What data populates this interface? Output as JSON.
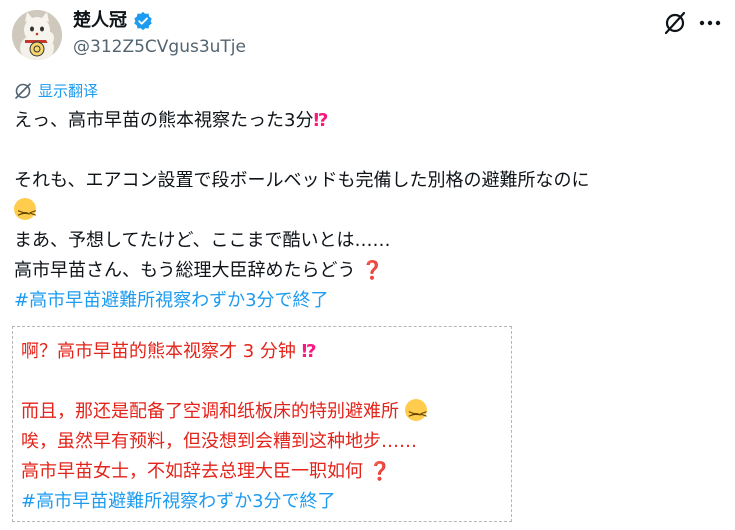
{
  "author": {
    "display_name": "楚人冠",
    "handle": "@312Z5CVgus3uTje",
    "verified": true,
    "avatar_icon": "maneki-neko-avatar"
  },
  "actions": {
    "grok_icon": "grok-icon",
    "more_icon": "more-horizontal-icon"
  },
  "translate": {
    "label": "显示翻译",
    "icon": "translate-icon"
  },
  "tweet": {
    "line1": "えっ、高市早苗の熊本視察たった3分",
    "line1_emoji": "⁉",
    "line2": "それも、エアコン設置で段ボールベッドも完備した別格の避難所なのに",
    "line3": "まあ、予想してたけど、ここまで酷いとは……",
    "line4": "高市早苗さん、もう総理大臣辞めたらどう",
    "line4_emoji": "❓",
    "hashtag": "#高市早苗避難所視察わずか3分で終了"
  },
  "translation": {
    "line1": "啊？高市早苗的熊本视察才 3 分钟",
    "line1_emoji": "⁉",
    "line2": "而且，那还是配备了空调和纸板床的特别避难所",
    "line3": "唉，虽然早有预料，但没想到会糟到这种地步……",
    "line4": "高市早苗女士，不如辞去总理大臣一职如何",
    "line4_emoji": "❓",
    "hashtag": "#高市早苗避難所視察わずか3分で終了"
  },
  "colors": {
    "link": "#1d9bf0",
    "translation_text": "#e3241b",
    "handle": "#536471"
  }
}
